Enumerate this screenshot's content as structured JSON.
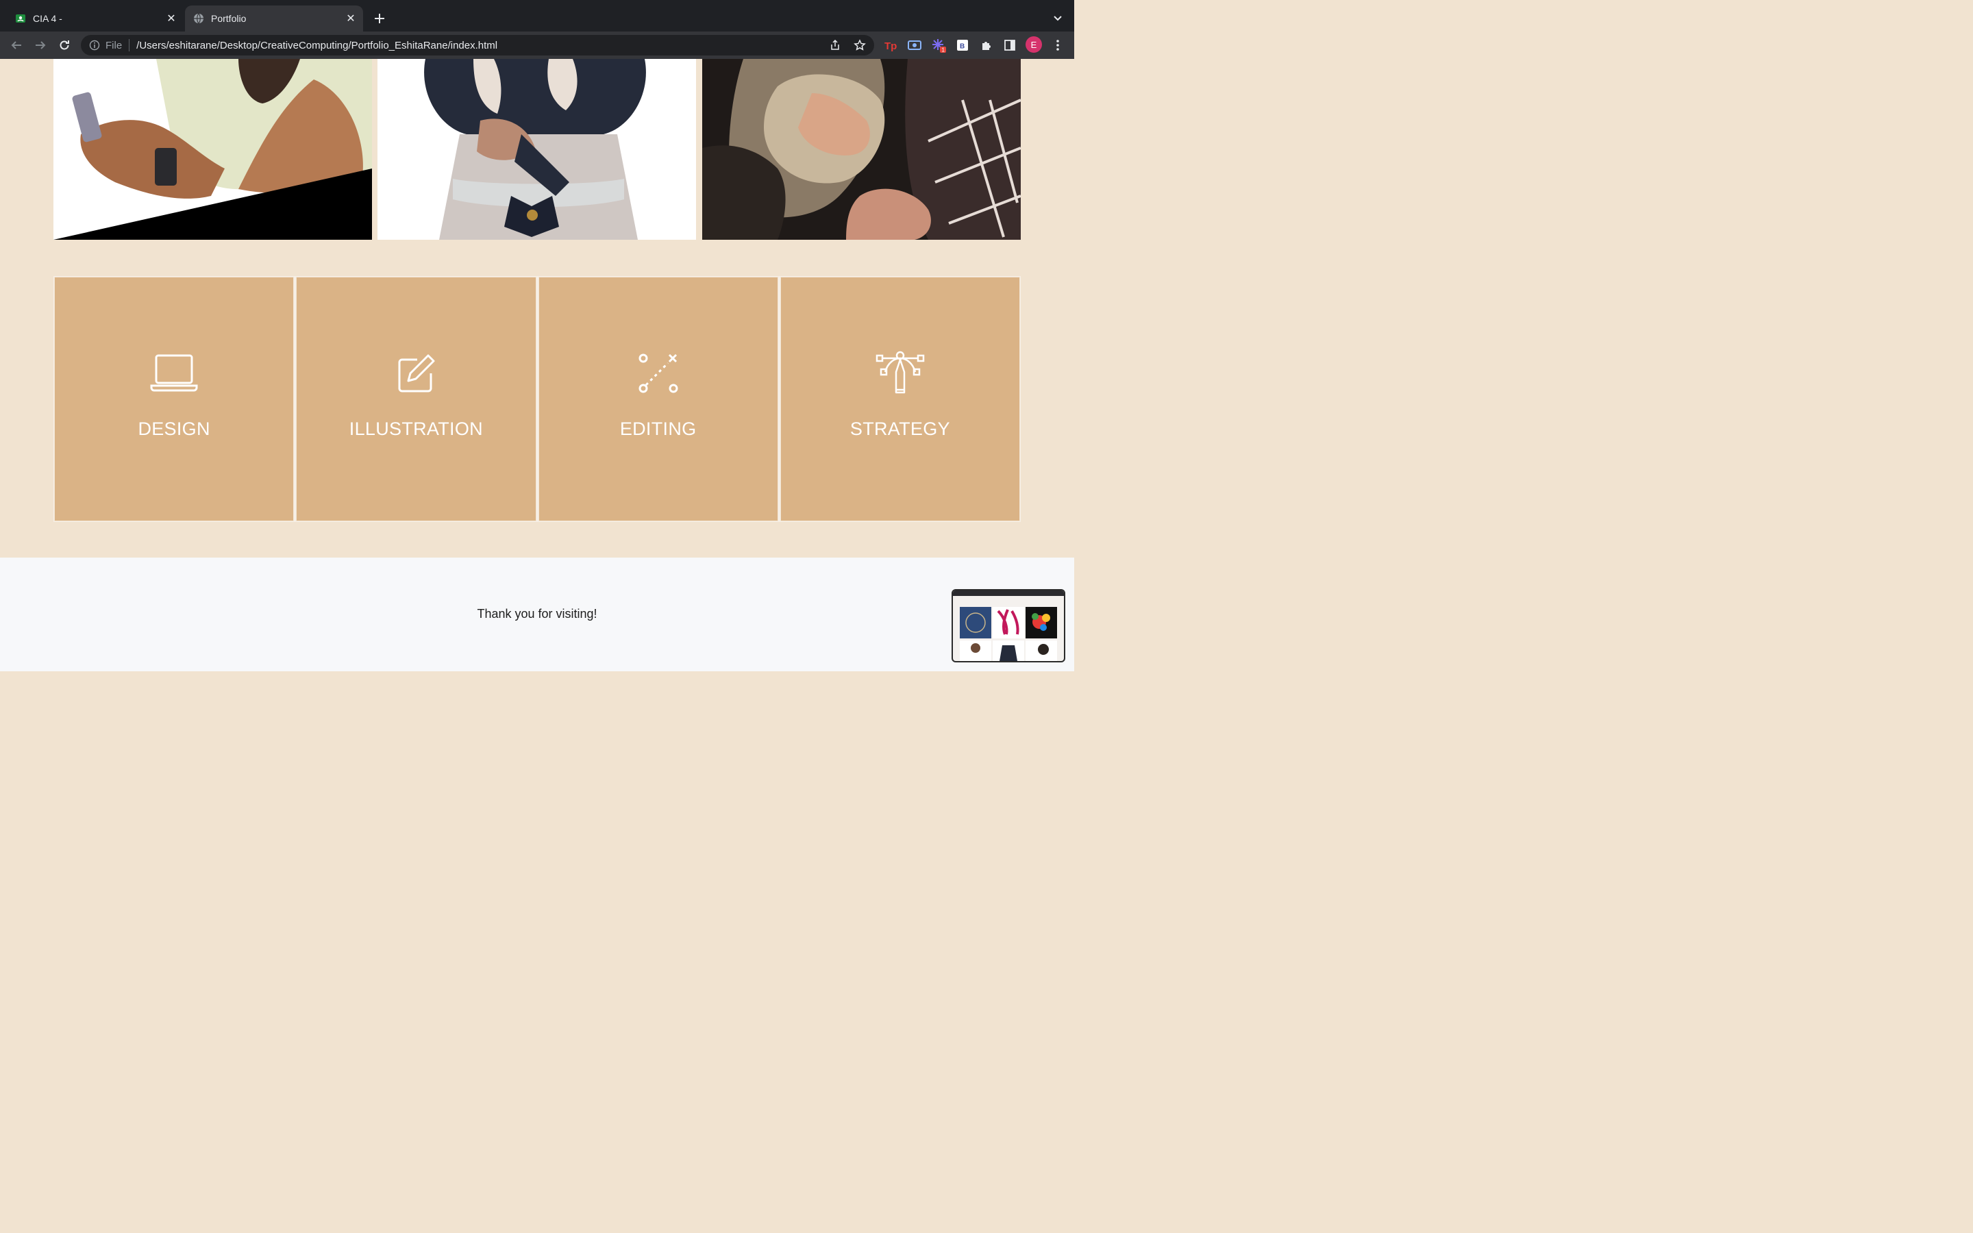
{
  "browser": {
    "tabs": [
      {
        "title": "CIA 4 -",
        "active": false,
        "favicon": "classroom-icon"
      },
      {
        "title": "Portfolio",
        "active": true,
        "favicon": "globe-icon"
      }
    ],
    "address": {
      "scheme": "File",
      "url": "/Users/eshitarane/Desktop/CreativeComputing/Portfolio_EshitaRane/index.html"
    },
    "profile_initial": "E",
    "extension_badge": "1",
    "bookmark_ext_letter": "B"
  },
  "gallery": {
    "items": [
      {
        "name": "illustration-man-phone"
      },
      {
        "name": "illustration-girl-dress"
      },
      {
        "name": "illustration-woman-dog"
      }
    ]
  },
  "services": [
    {
      "label": "DESIGN",
      "icon": "laptop-icon"
    },
    {
      "label": "ILLUSTRATION",
      "icon": "edit-icon"
    },
    {
      "label": "EDITING",
      "icon": "path-nodes-icon"
    },
    {
      "label": "STRATEGY",
      "icon": "pen-tool-icon"
    }
  ],
  "footer": {
    "message": "Thank you for visiting!"
  },
  "colors": {
    "page_bg": "#f1e3d0",
    "service_bg": "#dab386",
    "footer_bg": "#f7f8fa"
  }
}
